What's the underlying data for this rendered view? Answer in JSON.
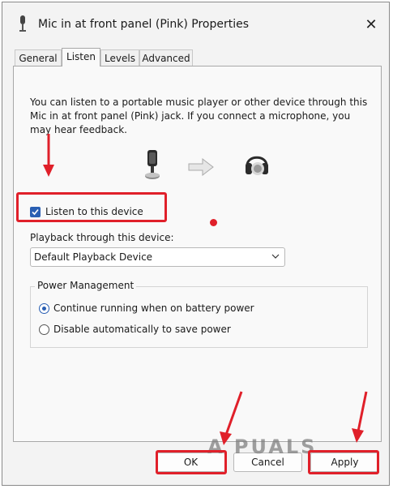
{
  "window": {
    "title": "Mic in at front panel (Pink) Properties",
    "close_glyph": "✕"
  },
  "tabs": [
    {
      "label": "General"
    },
    {
      "label": "Listen"
    },
    {
      "label": "Levels"
    },
    {
      "label": "Advanced"
    }
  ],
  "active_tab": "Listen",
  "listen": {
    "description": "You can listen to a portable music player or other device through this Mic in at front panel (Pink) jack.  If you connect a microphone, you may hear feedback.",
    "listen_checkbox_label": "Listen to this device",
    "listen_checked": true,
    "playback_label": "Playback through this device:",
    "playback_value": "Default Playback Device",
    "power_group_title": "Power Management",
    "power_options": [
      {
        "label": "Continue running when on battery power",
        "selected": true
      },
      {
        "label": "Disable automatically to save power",
        "selected": false
      }
    ]
  },
  "buttons": {
    "ok": "OK",
    "cancel": "Cancel",
    "apply": "Apply"
  },
  "watermark": "A  PUALS",
  "colors": {
    "accent": "#2a5fb3",
    "annotation_red": "#e0202a",
    "dialog_bg": "#f3f3f3",
    "panel_bg": "#f9f9f9"
  },
  "icons": {
    "app": "microphone-icon",
    "source": "microphone-icon",
    "flow": "arrow-right-icon",
    "destination": "headphones-icon"
  }
}
